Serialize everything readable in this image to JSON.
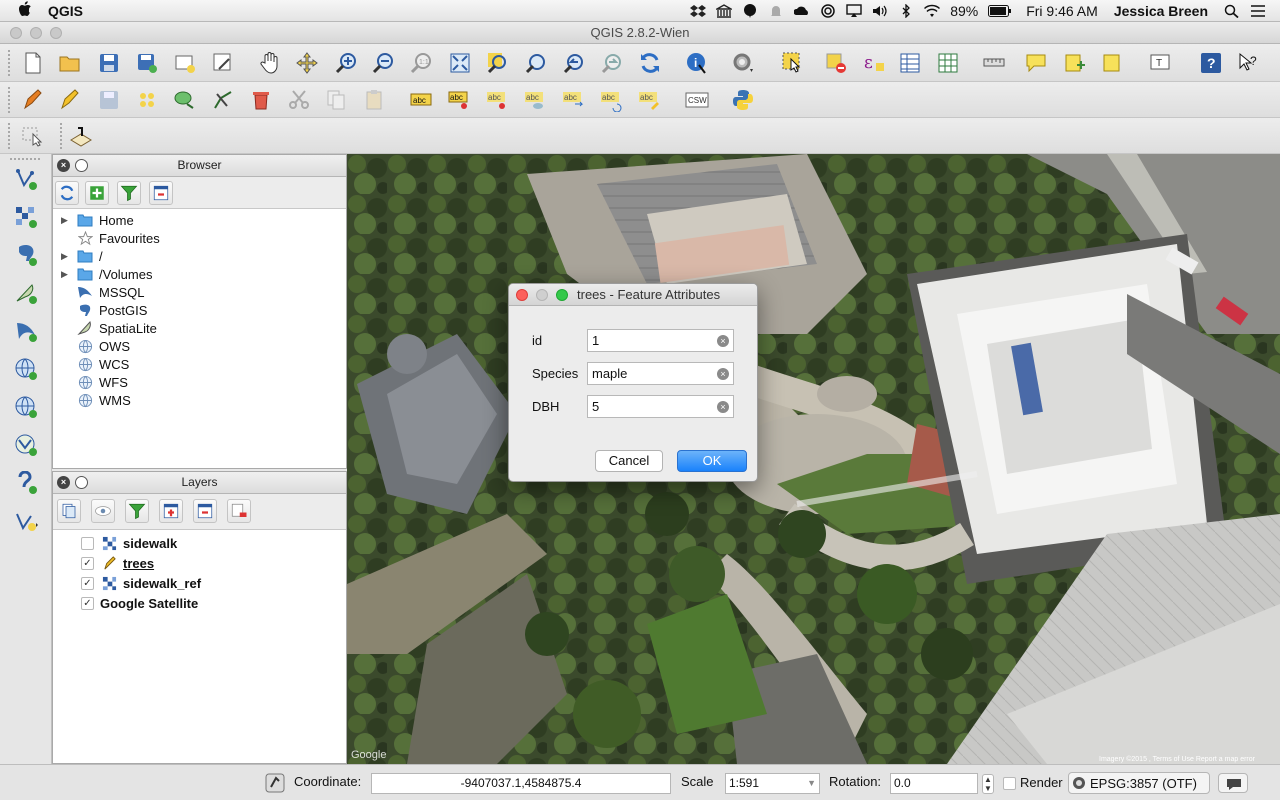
{
  "menubar": {
    "app_name": "QGIS",
    "battery": "89%",
    "clock": "Fri 9:46 AM",
    "user": "Jessica Breen"
  },
  "window": {
    "title": "QGIS 2.8.2-Wien"
  },
  "browser_panel": {
    "title": "Browser",
    "items": [
      {
        "label": "Home",
        "icon": "folder-icon",
        "expandable": true
      },
      {
        "label": "Favourites",
        "icon": "star-icon",
        "expandable": false
      },
      {
        "label": "/",
        "icon": "folder-icon",
        "expandable": true
      },
      {
        "label": "/Volumes",
        "icon": "folder-icon",
        "expandable": true
      },
      {
        "label": "MSSQL",
        "icon": "mssql-icon",
        "expandable": false
      },
      {
        "label": "PostGIS",
        "icon": "postgis-icon",
        "expandable": false
      },
      {
        "label": "SpatiaLite",
        "icon": "spatialite-icon",
        "expandable": false
      },
      {
        "label": "OWS",
        "icon": "globe-icon",
        "expandable": false
      },
      {
        "label": "WCS",
        "icon": "globe-icon",
        "expandable": false
      },
      {
        "label": "WFS",
        "icon": "globe-icon",
        "expandable": false
      },
      {
        "label": "WMS",
        "icon": "globe-icon",
        "expandable": false
      }
    ]
  },
  "layers_panel": {
    "title": "Layers",
    "layers": [
      {
        "name": "sidewalk",
        "checked": false,
        "icon": "raster-icon",
        "underline": false
      },
      {
        "name": "trees",
        "checked": true,
        "icon": "edit-pencil-icon",
        "underline": true
      },
      {
        "name": "sidewalk_ref",
        "checked": true,
        "icon": "raster-icon",
        "underline": false
      },
      {
        "name": "Google Satellite",
        "checked": true,
        "icon": "none",
        "underline": false
      }
    ]
  },
  "dialog": {
    "title": "trees - Feature Attributes",
    "fields": [
      {
        "label": "id",
        "value": "1"
      },
      {
        "label": "Species",
        "value": "maple"
      },
      {
        "label": "DBH",
        "value": "5"
      }
    ],
    "cancel_label": "Cancel",
    "ok_label": "OK"
  },
  "map": {
    "google_logo": "Google",
    "attribution": "Imagery ©2015 , Terms of Use   Report a map error"
  },
  "statusbar": {
    "coordinate_label": "Coordinate:",
    "coordinate_value": "-9407037.1,4584875.4",
    "scale_label": "Scale",
    "scale_value": "1:591",
    "rotation_label": "Rotation:",
    "rotation_value": "0.0",
    "render_label": "Render",
    "crs_label": "EPSG:3857 (OTF)"
  }
}
